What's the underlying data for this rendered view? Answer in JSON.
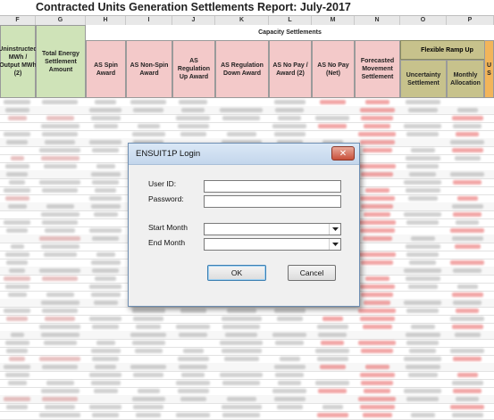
{
  "report": {
    "title": "Contracted Units Generation Settlements Report: July-2017",
    "columns": [
      "F",
      "G",
      "H",
      "I",
      "J",
      "K",
      "L",
      "M",
      "N",
      "O",
      "P"
    ],
    "group_capacity": "Capacity Settlements",
    "group_flexible": "Flexible Ramp Up",
    "headers": {
      "f": "Uninstructed MWh / Output MWh (2)",
      "g": "Total Energy Settlement Amount",
      "h": "AS Spin Award",
      "i": "AS Non-Spin Award",
      "j": "AS Regulation Up Award",
      "k": "AS Regulation Down Award",
      "l": "AS No Pay / Award (2)",
      "m": "AS No Pay (Net)",
      "n": "Forecasted Movement Settlement",
      "o": "Uncertainty Settlement",
      "p": "Monthly Allocation",
      "q": "U S"
    }
  },
  "dialog": {
    "title": "ENSUIT1P Login",
    "close_label": "✕",
    "user_id_label": "User ID:",
    "user_id_value": "",
    "password_label": "Password:",
    "password_value": "",
    "start_month_label": "Start Month",
    "start_month_value": "",
    "end_month_label": "End Month",
    "end_month_value": "",
    "ok_label": "OK",
    "cancel_label": "Cancel"
  },
  "colors": {
    "header_green": "#cfe3b8",
    "header_pink": "#f3c9c9",
    "header_olive": "#c7c28c",
    "header_orange": "#f2b55a",
    "value_red": "#e23b3b"
  }
}
